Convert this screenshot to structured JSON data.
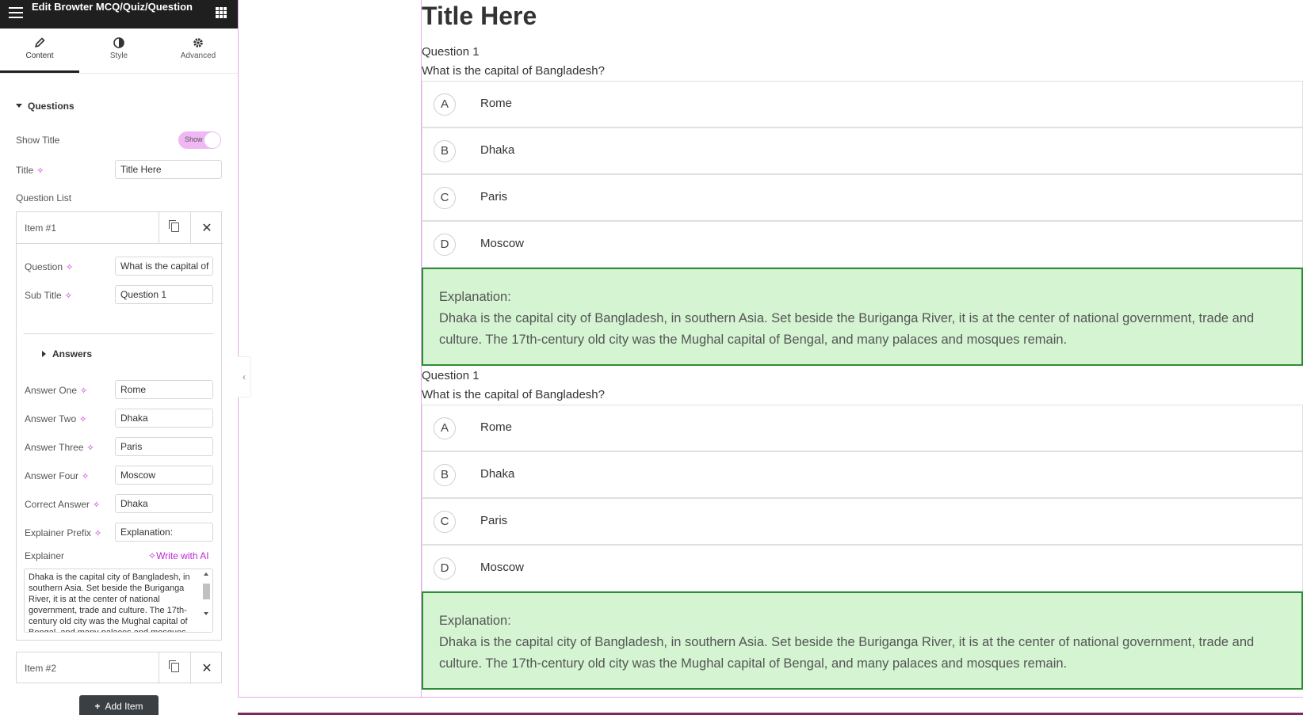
{
  "panel": {
    "title": "Edit Browter MCQ/Quiz/Question",
    "tabs": [
      {
        "label": "Content",
        "icon": "pencil-icon"
      },
      {
        "label": "Style",
        "icon": "contrast-icon"
      },
      {
        "label": "Advanced",
        "icon": "gear-icon"
      }
    ],
    "section_questions": "Questions",
    "show_title": {
      "label": "Show Title",
      "toggle_text": "Show"
    },
    "title_field": {
      "label": "Title",
      "value": "Title Here"
    },
    "question_list_label": "Question List",
    "items": [
      {
        "title": "Item #1",
        "question": {
          "label": "Question",
          "value": "What is the capital of"
        },
        "sub_title": {
          "label": "Sub Title",
          "value": "Question 1"
        },
        "answers_heading": "Answers",
        "answer_one": {
          "label": "Answer One",
          "value": "Rome"
        },
        "answer_two": {
          "label": "Answer Two",
          "value": "Dhaka"
        },
        "answer_three": {
          "label": "Answer Three",
          "value": "Paris"
        },
        "answer_four": {
          "label": "Answer Four",
          "value": "Moscow"
        },
        "correct_answer": {
          "label": "Correct Answer",
          "value": "Dhaka"
        },
        "explainer_prefix": {
          "label": "Explainer Prefix",
          "value": "Explanation:"
        },
        "explainer": {
          "label": "Explainer",
          "ai_link": "Write with AI",
          "value": "Dhaka is the capital city of Bangladesh, in southern Asia. Set beside the Buriganga River, it is at the center of national government, trade and culture. The 17th-century old city was the Mughal capital of Bengal, and many palaces and mosques remain."
        }
      },
      {
        "title": "Item #2"
      }
    ],
    "add_item": "Add Item"
  },
  "preview": {
    "title": "Title Here",
    "questions": [
      {
        "sub_title": "Question 1",
        "question": "What is the capital of Bangladesh?",
        "options": [
          {
            "letter": "A",
            "text": "Rome"
          },
          {
            "letter": "B",
            "text": "Dhaka"
          },
          {
            "letter": "C",
            "text": "Paris"
          },
          {
            "letter": "D",
            "text": "Moscow"
          }
        ],
        "explanation_prefix": "Explanation:",
        "explanation": "Dhaka is the capital city of Bangladesh, in southern Asia. Set beside the Buriganga River, it is at the center of national government, trade and culture. The 17th-century old city was the Mughal capital of Bengal, and many palaces and mosques remain."
      },
      {
        "sub_title": "Question 1",
        "question": "What is the capital of Bangladesh?",
        "options": [
          {
            "letter": "A",
            "text": "Rome"
          },
          {
            "letter": "B",
            "text": "Dhaka"
          },
          {
            "letter": "C",
            "text": "Paris"
          },
          {
            "letter": "D",
            "text": "Moscow"
          }
        ],
        "explanation_prefix": "Explanation:",
        "explanation": "Dhaka is the capital city of Bangladesh, in southern Asia. Set beside the Buriganga River, it is at the center of national government, trade and culture. The 17th-century old city was the Mughal capital of Bengal, and many palaces and mosques remain."
      }
    ]
  },
  "colors": {
    "accent": "#c026d3",
    "toggle_bg": "#f0b7f5",
    "explanation_bg": "#d4f4d2",
    "explanation_border": "#2f8c36",
    "header_bg": "#1f1f1f"
  }
}
